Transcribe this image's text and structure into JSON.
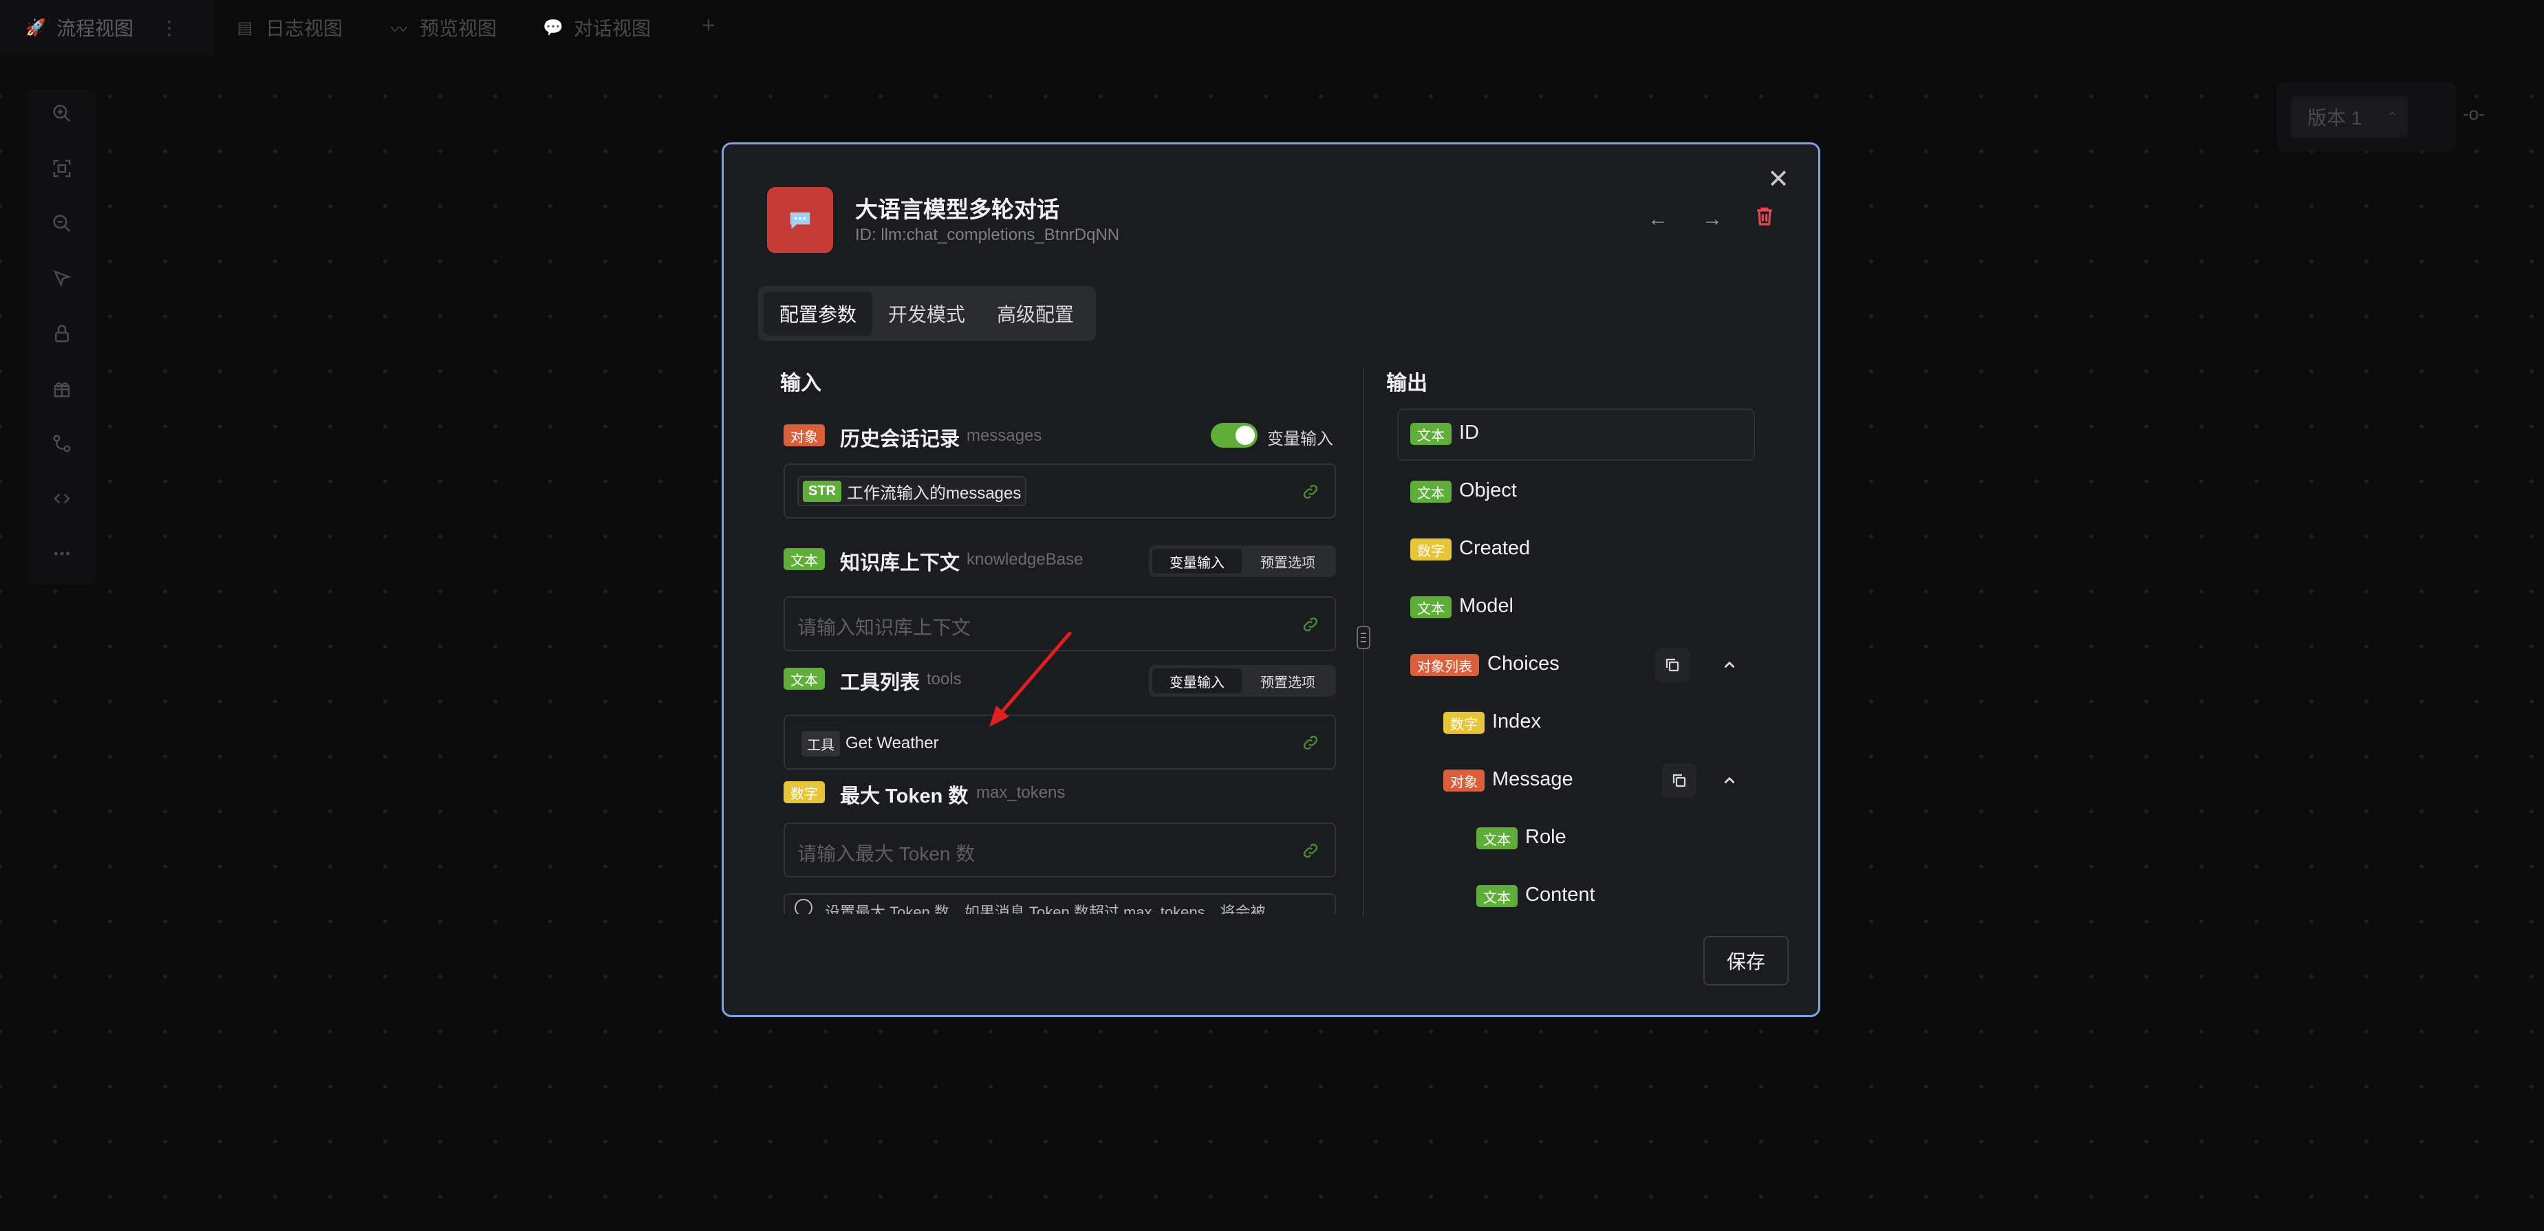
{
  "topbar": {
    "tabs": [
      {
        "label": "流程视图",
        "icon": "rocket-icon",
        "active": true
      },
      {
        "label": "日志视图",
        "icon": "log-icon"
      },
      {
        "label": "预览视图",
        "icon": "preview-icon"
      },
      {
        "label": "对话视图",
        "icon": "chat-icon"
      }
    ],
    "add_icon": "plus-icon"
  },
  "version": {
    "label": "版本 1"
  },
  "sidebar": {
    "icons": [
      "zoom-in-icon",
      "fit-view-icon",
      "zoom-out-icon",
      "pointer-icon",
      "lock-icon",
      "gift-icon",
      "flow-icon",
      "code-icon",
      "more-icon"
    ]
  },
  "modal": {
    "title": "大语言模型多轮对话",
    "id_text": "ID: llm:chat_completions_BtnrDqNN",
    "tabs": [
      "配置参数",
      "开发模式",
      "高级配置"
    ],
    "active_tab": "配置参数",
    "save_label": "保存",
    "accent_color": "#7ba5e4"
  },
  "inputs": {
    "title": "输入",
    "fields": [
      {
        "badge": "对象",
        "label": "历史会话记录",
        "key": "messages",
        "toggle_label": "变量输入",
        "toggle_on": true,
        "chip_type": "STR",
        "chip_text": "工作流输入的messages"
      },
      {
        "badge": "文本",
        "label": "知识库上下文",
        "key": "knowledgeBase",
        "seg": [
          "变量输入",
          "预置选项"
        ],
        "placeholder": "请输入知识库上下文"
      },
      {
        "badge": "文本",
        "label": "工具列表",
        "key": "tools",
        "seg": [
          "变量输入",
          "预置选项"
        ],
        "chip_type": "工具",
        "chip_text": "Get Weather"
      },
      {
        "badge": "数字",
        "label": "最大 Token 数",
        "key": "max_tokens",
        "placeholder": "请输入最大 Token 数"
      }
    ],
    "note": "设置最大 Token 数，如果消息 Token 数超过 max_tokens，将会被"
  },
  "outputs": {
    "title": "输出",
    "items": [
      {
        "badge": "文本",
        "name": "ID"
      },
      {
        "badge": "文本",
        "name": "Object"
      },
      {
        "badge": "数字",
        "name": "Created"
      },
      {
        "badge": "文本",
        "name": "Model"
      },
      {
        "badge": "对象列表",
        "name": "Choices"
      },
      {
        "badge": "数字",
        "name": "Index"
      },
      {
        "badge": "对象",
        "name": "Message"
      },
      {
        "badge": "文本",
        "name": "Role"
      },
      {
        "badge": "文本",
        "name": "Content"
      }
    ]
  },
  "colors": {
    "badge_object": "#d9603b",
    "badge_text": "#5fae3a",
    "badge_number": "#e6c53a",
    "delete": "#e5484d",
    "annotation_arrow": "#e02020"
  }
}
